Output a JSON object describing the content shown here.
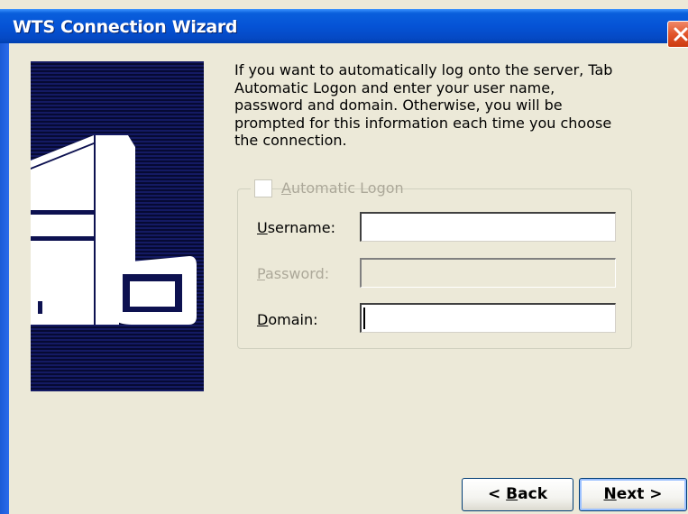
{
  "window": {
    "title": "WTS Connection Wizard"
  },
  "description": "If you want to automatically log onto the server, Tab Automatic Logon and enter your user name, password and domain. Otherwise, you will be prompted for this information each time you choose the connection.",
  "auto_logon": {
    "label_hotkey": "A",
    "label_rest": "utomatic Logon",
    "checked": false
  },
  "fields": {
    "username": {
      "hotkey": "U",
      "rest": "sername:",
      "value": "",
      "enabled": true
    },
    "password": {
      "hotkey": "P",
      "rest": "assword:",
      "value": "",
      "enabled": false
    },
    "domain": {
      "hotkey": "D",
      "rest": "omain:",
      "value": "",
      "enabled": true
    }
  },
  "buttons": {
    "back": {
      "prefix": "< ",
      "hotkey": "B",
      "rest": "ack"
    },
    "next": {
      "hotkey": "N",
      "rest": "ext >"
    }
  },
  "colors": {
    "titlebar": "#0553d6",
    "dialog_background": "#ece9d8",
    "art_panel": "#0d1150",
    "close_button": "#e2552a",
    "disabled_text": "#aca899"
  },
  "icons": {
    "close": "close-icon",
    "art": "server-computer-illustration"
  }
}
